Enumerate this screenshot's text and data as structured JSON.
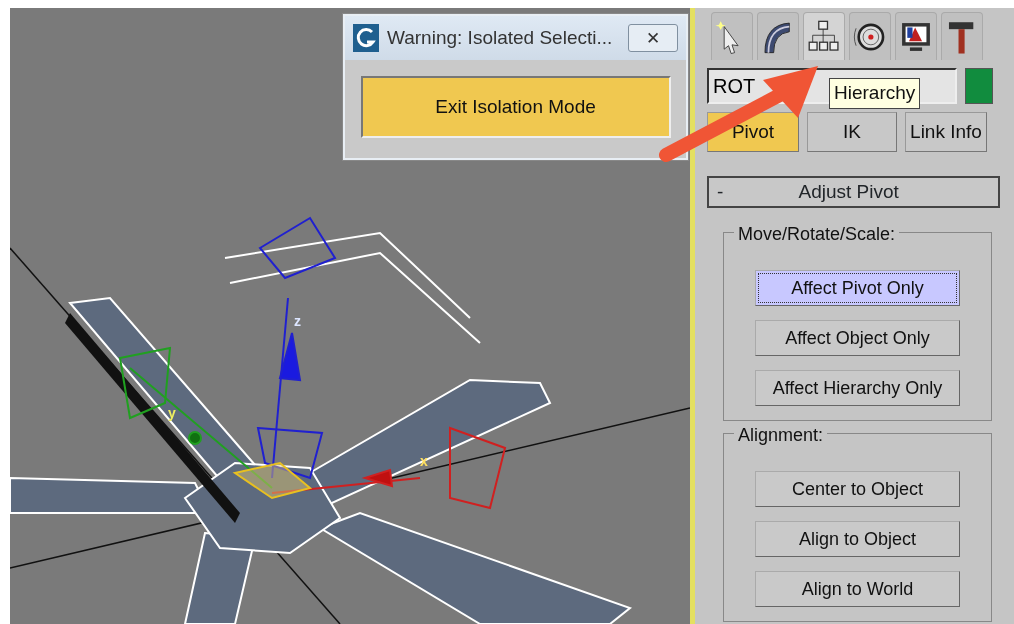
{
  "dialog": {
    "title": "Warning: Isolated Selecti...",
    "close": "✕",
    "button": "Exit Isolation Mode"
  },
  "viewport": {
    "axis_labels": [
      "z",
      "y",
      "x"
    ]
  },
  "panel_tabs": [
    {
      "kind": "create",
      "selected": false
    },
    {
      "kind": "modify",
      "selected": false
    },
    {
      "kind": "hierarchy",
      "selected": true
    },
    {
      "kind": "motion",
      "selected": false
    },
    {
      "kind": "display",
      "selected": false
    },
    {
      "kind": "utilities",
      "selected": false
    }
  ],
  "object_name": "ROT",
  "tooltip": "Hierarchy",
  "subtabs": [
    {
      "label": "Pivot",
      "selected": true
    },
    {
      "label": "IK",
      "selected": false
    },
    {
      "label": "Link Info",
      "selected": false
    }
  ],
  "rollout": {
    "toggle": "-",
    "title": "Adjust Pivot",
    "groups": [
      {
        "title": "Move/Rotate/Scale:",
        "buttons": [
          {
            "label": "Affect Pivot Only",
            "selected": true
          },
          {
            "label": "Affect Object Only",
            "selected": false
          },
          {
            "label": "Affect Hierarchy Only",
            "selected": false
          }
        ]
      },
      {
        "title": "Alignment:",
        "buttons": [
          {
            "label": "Center to Object",
            "selected": false
          },
          {
            "label": "Align to Object",
            "selected": false
          },
          {
            "label": "Align to World",
            "selected": false
          }
        ]
      }
    ]
  }
}
